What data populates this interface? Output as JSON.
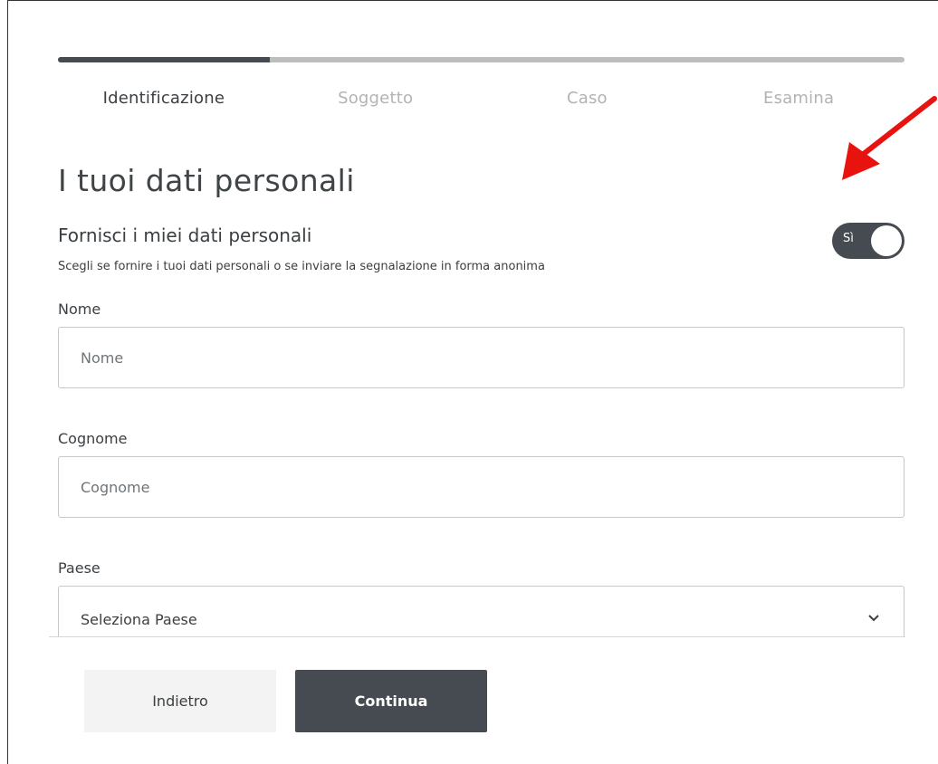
{
  "progress": {
    "fraction": 0.25
  },
  "steps": [
    {
      "label": "Identificazione",
      "active": true
    },
    {
      "label": "Soggetto",
      "active": false
    },
    {
      "label": "Caso",
      "active": false
    },
    {
      "label": "Esamina",
      "active": false
    }
  ],
  "page_title": "I tuoi dati personali",
  "personal_data": {
    "title": "Fornisci i miei dati personali",
    "description": "Scegli se fornire i tuoi dati personali o se inviare la segnalazione in forma anonima",
    "toggle_label": "Sì",
    "toggle_on": true
  },
  "fields": {
    "nome": {
      "label": "Nome",
      "placeholder": "Nome",
      "value": ""
    },
    "cognome": {
      "label": "Cognome",
      "placeholder": "Cognome",
      "value": ""
    },
    "paese": {
      "label": "Paese",
      "selected": "Seleziona Paese"
    }
  },
  "buttons": {
    "back": "Indietro",
    "continue": "Continua"
  },
  "colors": {
    "accent": "#454b50",
    "annotation_arrow": "#e8130f"
  },
  "icons": {
    "dropdown": "chevron-down-icon",
    "annotation": "red-arrow-icon"
  }
}
